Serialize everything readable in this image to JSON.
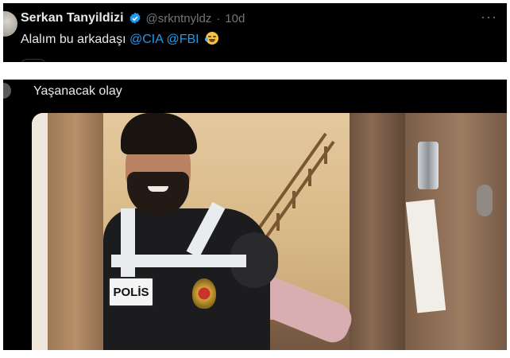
{
  "tweet": {
    "display_name": "Serkan Tanyildizi",
    "handle": "@srkntnyldz",
    "separator": "·",
    "time": "10d",
    "more_label": "···",
    "text_prefix": "Alalım bu arkadaşı",
    "mentions": [
      "@CIA",
      "@FBI"
    ],
    "emoji": "face-with-tears-of-joy-icon",
    "colors": {
      "background": "#000000",
      "text": "#e7e9ea",
      "secondary": "#71767b",
      "link": "#1d9bf0",
      "verified": "#1d9bf0"
    }
  },
  "meme": {
    "caption": "Yaşanacak olay",
    "vest_text": "POLİS",
    "description_icon": "police-vest-photo"
  }
}
